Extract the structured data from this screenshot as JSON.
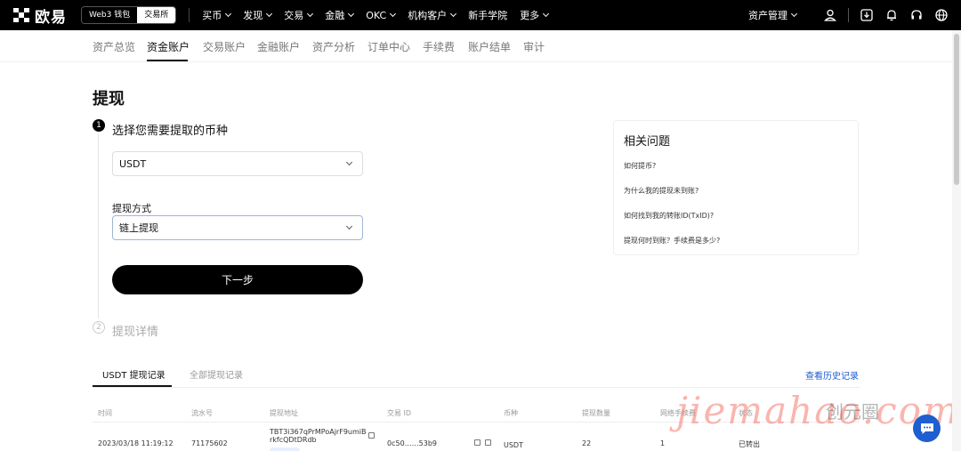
{
  "header": {
    "logo_text": "欧易",
    "mode_switch": [
      "Web3 钱包",
      "交易所"
    ],
    "nav": [
      {
        "label": "买币",
        "dropdown": true
      },
      {
        "label": "发现",
        "dropdown": true
      },
      {
        "label": "交易",
        "dropdown": true
      },
      {
        "label": "金融",
        "dropdown": true
      },
      {
        "label": "OKC",
        "dropdown": true
      },
      {
        "label": "机构客户",
        "dropdown": true
      },
      {
        "label": "新手学院",
        "dropdown": false
      },
      {
        "label": "更多",
        "dropdown": true
      }
    ],
    "asset_management": "资产管理",
    "icons": [
      "user-icon",
      "download-icon",
      "bell-icon",
      "headset-icon",
      "globe-icon"
    ]
  },
  "subnav": {
    "items": [
      "资产总览",
      "资金账户",
      "交易账户",
      "金融账户",
      "资产分析",
      "订单中心",
      "手续费",
      "账户结单",
      "审计"
    ],
    "active": "资金账户"
  },
  "page": {
    "title": "提现",
    "step1": {
      "number": "1",
      "title": "选择您需要提取的币种"
    },
    "coin_select": {
      "value": "USDT"
    },
    "method": {
      "label": "提现方式",
      "value": "链上提现"
    },
    "next_button": "下一步",
    "step2": {
      "number": "2",
      "title": "提现详情"
    }
  },
  "faq": {
    "title": "相关问题",
    "items": [
      "如何提币?",
      "为什么我的提现未到账?",
      "如何找到我的转账ID(TxID)?",
      "提现何时到账？手续费是多少?"
    ]
  },
  "records": {
    "tabs": [
      "USDT 提现记录",
      "全部提现记录"
    ],
    "active_tab": "USDT 提现记录",
    "history_link": "查看历史记录",
    "columns": [
      "时间",
      "流水号",
      "提现地址",
      "交易 ID",
      "币种",
      "提现数量",
      "网络手续费",
      "状态"
    ],
    "rows": [
      {
        "time": "2023/03/18 11:19:12",
        "serial": "71175602",
        "address_line1": "TBT3i367qPrMPoAjrF9umiB",
        "address_line2": "rkfcQDtDRdb",
        "txid": "0c50……53b9",
        "coin": "USDT",
        "amount": "22",
        "fee": "1",
        "status": "已转出"
      }
    ]
  },
  "watermark": {
    "text": "jiemahao.com",
    "right_text": "创元圈"
  },
  "colors": {
    "topbar": "#000000",
    "link": "#1f5ecf",
    "watermark": "#f4786e"
  }
}
